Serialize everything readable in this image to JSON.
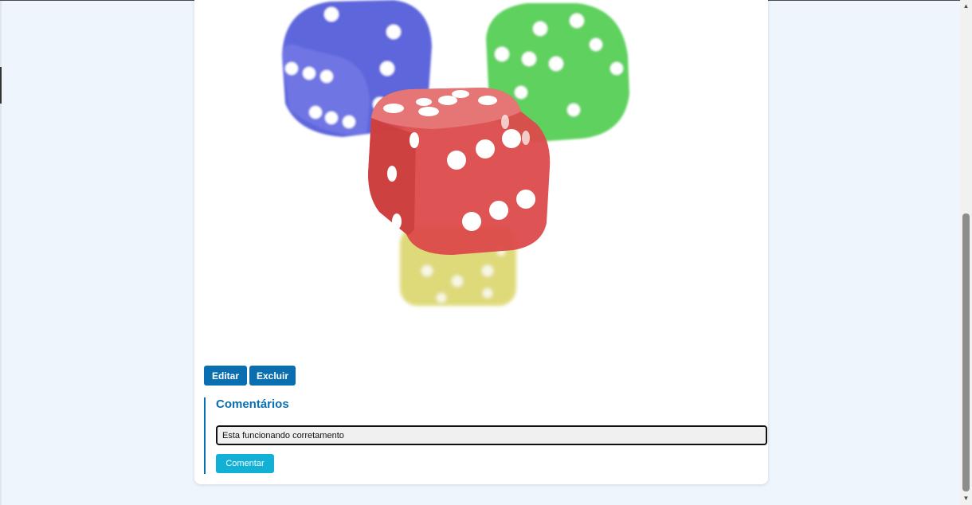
{
  "post": {
    "image_alt": "dice",
    "actions": {
      "edit_label": "Editar",
      "delete_label": "Excluir"
    }
  },
  "comments": {
    "title": "Comentários",
    "input_value": "Esta funcionando corretamento",
    "submit_label": "Comentar"
  },
  "colors": {
    "page_bg": "#eef5fd",
    "primary": "#0a6fb0",
    "comment_button": "#13b0d6",
    "dice": [
      "blue",
      "green",
      "red",
      "yellow"
    ]
  }
}
